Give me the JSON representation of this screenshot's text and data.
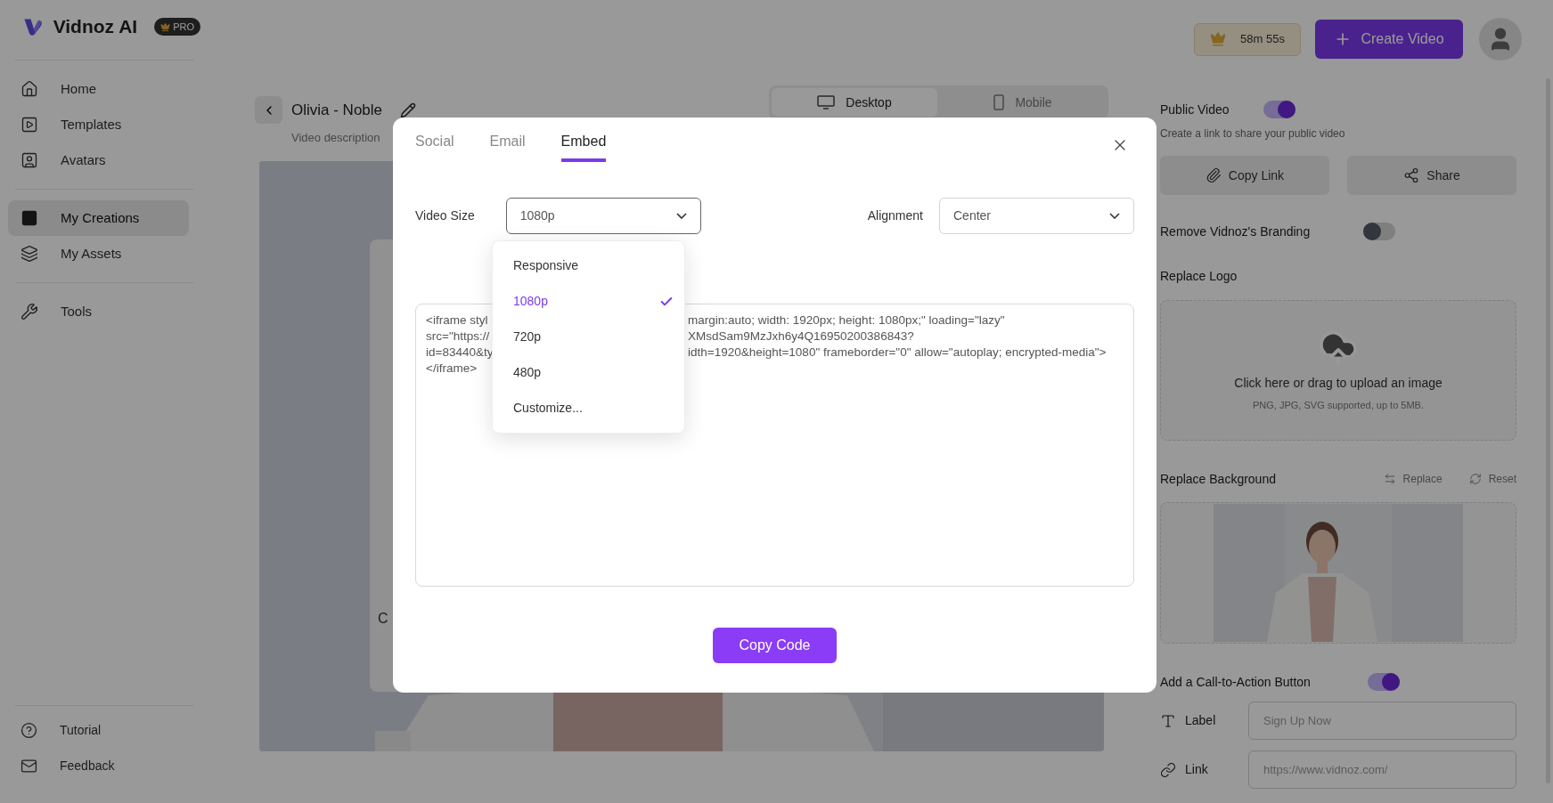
{
  "sidebar": {
    "brand": "Vidnoz AI",
    "badge": "PRO",
    "items": [
      {
        "label": "Home",
        "selected": false
      },
      {
        "label": "Templates",
        "selected": false
      },
      {
        "label": "Avatars",
        "selected": false
      },
      {
        "label": "My Creations",
        "selected": true
      },
      {
        "label": "My Assets",
        "selected": false
      },
      {
        "label": "Tools",
        "selected": false
      }
    ],
    "footer_items": [
      {
        "label": "Tutorial"
      },
      {
        "label": "Feedback"
      }
    ]
  },
  "header": {
    "timer": "58m 55s",
    "create_button": "Create Video"
  },
  "editor": {
    "title": "Olivia - Noble",
    "description": "Video description",
    "view_tabs": [
      {
        "label": "Desktop",
        "selected": true
      },
      {
        "label": "Mobile",
        "selected": false
      }
    ],
    "card_text": "C"
  },
  "right_panel": {
    "public_video": {
      "label": "Public Video",
      "on": true,
      "hint": "Create a link to share your public video"
    },
    "buttons": [
      {
        "label": "Copy Link"
      },
      {
        "label": "Share"
      }
    ],
    "branding": {
      "label": "Remove Vidnoz's Branding",
      "on": false
    },
    "logo": {
      "label": "Replace Logo",
      "upload_text": "Click here or drag to upload an image",
      "upload_hint": "PNG, JPG, SVG supported, up to 5MB."
    },
    "background": {
      "label": "Replace Background",
      "actions": [
        {
          "label": "Replace"
        },
        {
          "label": "Reset"
        }
      ]
    },
    "cta": {
      "label": "Add a Call-to-Action Button",
      "on": true,
      "fields": [
        {
          "label": "Label",
          "placeholder": "Sign Up Now"
        },
        {
          "label": "Link",
          "placeholder": "https://www.vidnoz.com/"
        }
      ]
    }
  },
  "modal": {
    "tabs": [
      {
        "label": "Social",
        "selected": false
      },
      {
        "label": "Email",
        "selected": false
      },
      {
        "label": "Embed",
        "selected": true
      }
    ],
    "video_size": {
      "label": "Video Size",
      "value": "1080p",
      "expanded": true,
      "options": [
        {
          "label": "Responsive",
          "selected": false
        },
        {
          "label": "1080p",
          "selected": true
        },
        {
          "label": "720p",
          "selected": false
        },
        {
          "label": "480p",
          "selected": false
        },
        {
          "label": "Customize...",
          "selected": false
        }
      ]
    },
    "alignment": {
      "label": "Alignment",
      "value": "Center"
    },
    "code_lines": [
      {
        "left": "<iframe styl",
        "right": "margin:auto; width: 1920px; height: 1080px;\" loading=\"lazy\""
      },
      {
        "left": "src=\"https://",
        "right": "XMsdSam9MzJxh6y4Q16950200386843?"
      },
      {
        "left": "id=83440&ty",
        "right": "idth=1920&height=1080\" frameborder=\"0\" allow=\"autoplay; encrypted-media\">"
      },
      {
        "left": "</iframe>"
      }
    ],
    "copy_button": "Copy Code"
  }
}
